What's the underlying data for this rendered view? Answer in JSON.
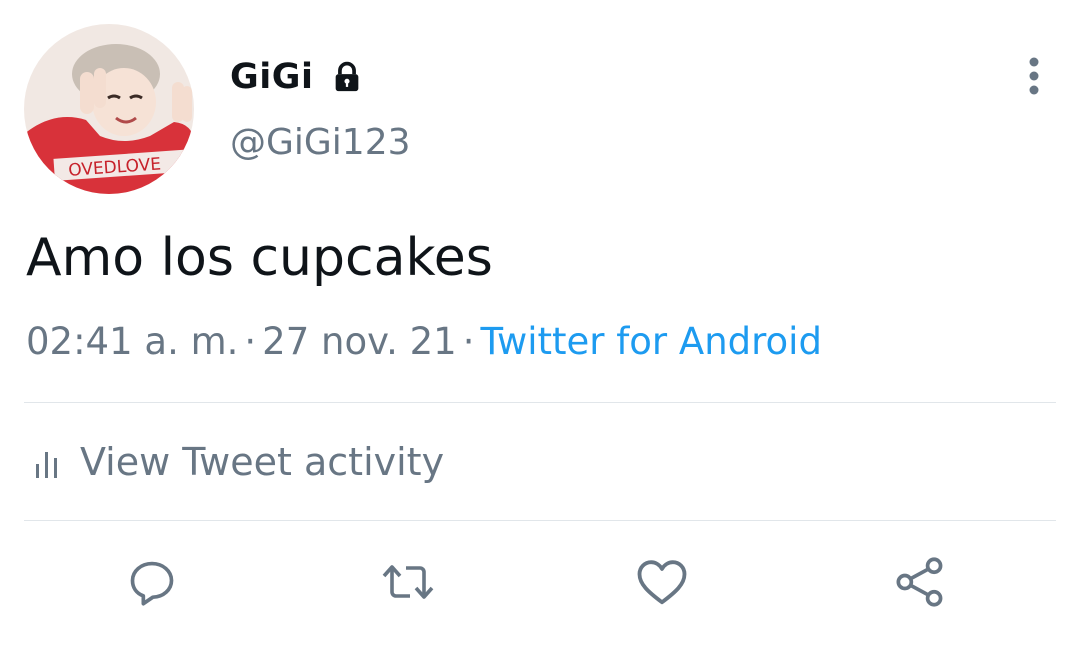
{
  "author": {
    "display_name": "GiGi",
    "username": "@GiGi123",
    "avatar_icon": "avatar-photo",
    "protected_icon": "lock-icon"
  },
  "tweet": {
    "text": "Amo los cupcakes",
    "time": "02:41 a. m.",
    "separator": "·",
    "date": "27 nov. 21",
    "source": "Twitter for Android"
  },
  "activity": {
    "label": "View Tweet activity",
    "icon": "analytics-icon"
  },
  "actions": {
    "reply_icon": "reply-icon",
    "retweet_icon": "retweet-icon",
    "like_icon": "heart-icon",
    "share_icon": "share-icon",
    "more_icon": "more-vertical-icon"
  },
  "colors": {
    "text": "#0f1419",
    "secondary": "#687684",
    "link": "#1d9bf0",
    "divider": "#e1e6ea"
  }
}
